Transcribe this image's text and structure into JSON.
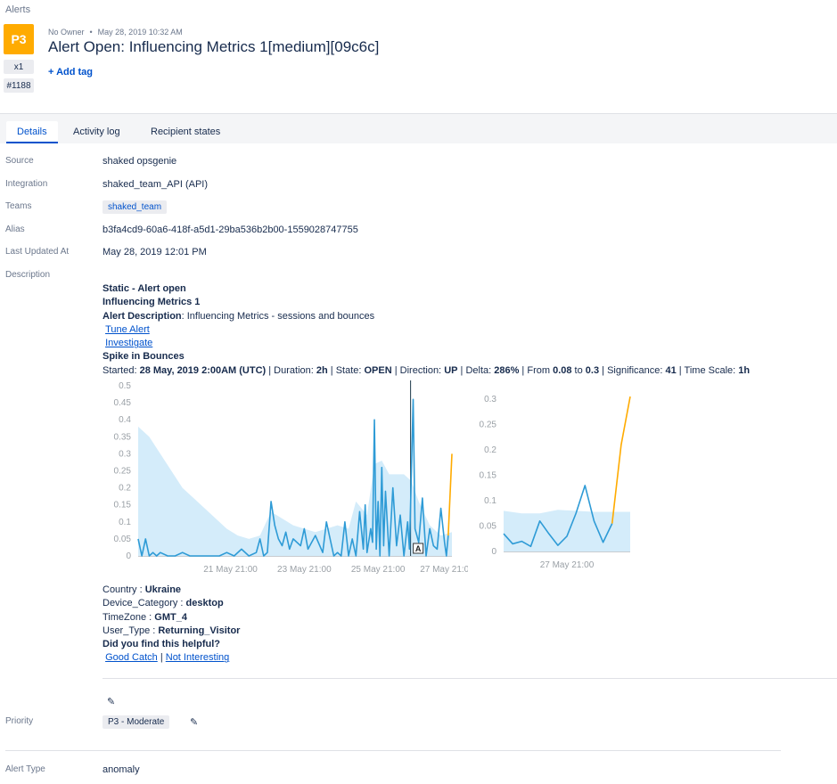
{
  "breadcrumb": "Alerts",
  "alert": {
    "priority_badge": "P3",
    "count": "x1",
    "tiny_id": "#1188",
    "owner": "No Owner",
    "created": "May 28, 2019 10:32 AM",
    "title": "Alert Open: Influencing Metrics 1[medium][09c6c]",
    "add_tag": "+ Add tag"
  },
  "tabs": [
    "Details",
    "Activity log",
    "Recipient states"
  ],
  "details": {
    "source_label": "Source",
    "source": "shaked opsgenie",
    "integration_label": "Integration",
    "integration": "shaked_team_API (API)",
    "teams_label": "Teams",
    "team": "shaked_team",
    "alias_label": "Alias",
    "alias": "b3fa4cd9-60a6-418f-a5d1-29ba536b2b00-1559028747755",
    "updated_label": "Last Updated At",
    "updated": "May 28, 2019 12:01 PM",
    "description_label": "Description",
    "priority_label": "Priority",
    "priority": "P3 - Moderate",
    "type_label": "Alert Type",
    "type": "anomaly"
  },
  "description": {
    "line1": "Static - Alert open",
    "line2": "Influencing Metrics 1",
    "desc_key": "Alert Description",
    "desc_val": ": Influencing Metrics - sessions and bounces",
    "tune_link": "Tune Alert",
    "investigate_link": "Investigate",
    "spike": "Spike in Bounces",
    "started_pre": "Started: ",
    "started": "28 May, 2019 2:00AM (UTC)",
    "duration_pre": " | Duration: ",
    "duration": "2h",
    "state_pre": " | State: ",
    "state": "OPEN",
    "direction_pre": " | Direction: ",
    "direction": "UP",
    "delta_pre": " | Delta: ",
    "delta": "286%",
    "from_pre": " | From ",
    "from": "0.08",
    "to_pre": " to ",
    "to": "0.3",
    "sig_pre": " | Significance: ",
    "sig": "41",
    "ts_pre": " | Time Scale: ",
    "ts": "1h",
    "country_key": "Country : ",
    "country": "Ukraine",
    "device_key": "Device_Category : ",
    "device": "desktop",
    "tz_key": "TimeZone : ",
    "tz": "GMT_4",
    "user_key": "User_Type : ",
    "user": "Returning_Visitor",
    "helpful": "Did you find this helpful?",
    "good_catch": "Good Catch",
    "sep": " | ",
    "not_interesting": "Not Interesting"
  },
  "chart_data": [
    {
      "type": "line",
      "ylim": [
        0,
        0.5
      ],
      "yticks": [
        0,
        0.05,
        0.1,
        0.15,
        0.2,
        0.25,
        0.3,
        0.35,
        0.4,
        0.45,
        0.5
      ],
      "xticks": [
        "21 May 21:00",
        "23 May 21:00",
        "25 May 21:00",
        "27 May 21:0"
      ],
      "xtick_pos": [
        2.5,
        4.5,
        6.5,
        8.3
      ],
      "xlim": [
        0,
        8.5
      ],
      "annotation": "A",
      "series": [
        {
          "color": "#2e9bd6",
          "points": [
            [
              0.0,
              0.05
            ],
            [
              0.1,
              0.0
            ],
            [
              0.2,
              0.05
            ],
            [
              0.3,
              0.0
            ],
            [
              0.4,
              0.01
            ],
            [
              0.5,
              0.0
            ],
            [
              0.6,
              0.01
            ],
            [
              0.8,
              0.0
            ],
            [
              1.0,
              0.0
            ],
            [
              1.2,
              0.01
            ],
            [
              1.4,
              0.0
            ],
            [
              1.6,
              0.0
            ],
            [
              1.8,
              0.0
            ],
            [
              2.0,
              0.0
            ],
            [
              2.2,
              0.0
            ],
            [
              2.4,
              0.01
            ],
            [
              2.6,
              0.0
            ],
            [
              2.8,
              0.02
            ],
            [
              3.0,
              0.0
            ],
            [
              3.2,
              0.01
            ],
            [
              3.3,
              0.05
            ],
            [
              3.4,
              0.0
            ],
            [
              3.5,
              0.01
            ],
            [
              3.6,
              0.16
            ],
            [
              3.7,
              0.09
            ],
            [
              3.8,
              0.05
            ],
            [
              3.9,
              0.03
            ],
            [
              4.0,
              0.07
            ],
            [
              4.1,
              0.02
            ],
            [
              4.2,
              0.05
            ],
            [
              4.4,
              0.03
            ],
            [
              4.5,
              0.08
            ],
            [
              4.6,
              0.02
            ],
            [
              4.7,
              0.04
            ],
            [
              4.8,
              0.06
            ],
            [
              5.0,
              0.01
            ],
            [
              5.1,
              0.1
            ],
            [
              5.2,
              0.05
            ],
            [
              5.3,
              0.0
            ],
            [
              5.4,
              0.01
            ],
            [
              5.5,
              0.0
            ],
            [
              5.6,
              0.1
            ],
            [
              5.7,
              0.0
            ],
            [
              5.8,
              0.05
            ],
            [
              5.9,
              0.0
            ],
            [
              6.0,
              0.13
            ],
            [
              6.1,
              0.02
            ],
            [
              6.15,
              0.15
            ],
            [
              6.2,
              0.01
            ],
            [
              6.3,
              0.08
            ],
            [
              6.35,
              0.04
            ],
            [
              6.4,
              0.4
            ],
            [
              6.45,
              0.02
            ],
            [
              6.5,
              0.16
            ],
            [
              6.55,
              0.0
            ],
            [
              6.6,
              0.26
            ],
            [
              6.65,
              0.03
            ],
            [
              6.7,
              0.19
            ],
            [
              6.8,
              0.0
            ],
            [
              6.9,
              0.2
            ],
            [
              7.0,
              0.03
            ],
            [
              7.1,
              0.12
            ],
            [
              7.2,
              0.0
            ],
            [
              7.3,
              0.1
            ],
            [
              7.35,
              0.02
            ],
            [
              7.45,
              0.46
            ],
            [
              7.5,
              0.08
            ],
            [
              7.6,
              0.04
            ],
            [
              7.7,
              0.17
            ],
            [
              7.8,
              0.0
            ],
            [
              7.9,
              0.08
            ],
            [
              8.0,
              0.03
            ],
            [
              8.1,
              0.02
            ],
            [
              8.2,
              0.14
            ],
            [
              8.3,
              0.04
            ],
            [
              8.35,
              0.0
            ],
            [
              8.4,
              0.06
            ]
          ]
        },
        {
          "color": "#ffab00",
          "points": [
            [
              8.4,
              0.06
            ],
            [
              8.5,
              0.3
            ]
          ]
        }
      ],
      "band": [
        [
          0.0,
          0.38
        ],
        [
          0.3,
          0.35
        ],
        [
          0.6,
          0.3
        ],
        [
          0.9,
          0.25
        ],
        [
          1.2,
          0.2
        ],
        [
          1.5,
          0.17
        ],
        [
          1.8,
          0.14
        ],
        [
          2.1,
          0.11
        ],
        [
          2.4,
          0.08
        ],
        [
          2.7,
          0.06
        ],
        [
          3.0,
          0.05
        ],
        [
          3.3,
          0.06
        ],
        [
          3.6,
          0.13
        ],
        [
          3.9,
          0.11
        ],
        [
          4.2,
          0.09
        ],
        [
          4.5,
          0.08
        ],
        [
          4.8,
          0.07
        ],
        [
          5.1,
          0.08
        ],
        [
          5.4,
          0.09
        ],
        [
          5.7,
          0.08
        ],
        [
          5.9,
          0.16
        ],
        [
          6.2,
          0.12
        ],
        [
          6.4,
          0.27
        ],
        [
          6.6,
          0.28
        ],
        [
          6.8,
          0.24
        ],
        [
          7.0,
          0.24
        ],
        [
          7.2,
          0.24
        ],
        [
          7.4,
          0.22
        ],
        [
          7.6,
          0.16
        ],
        [
          7.9,
          0.09
        ],
        [
          8.2,
          0.06
        ],
        [
          8.5,
          0.07
        ]
      ],
      "marker_x": 7.38
    },
    {
      "type": "line",
      "ylim": [
        0,
        0.3
      ],
      "yticks": [
        0,
        0.05,
        0.1,
        0.15,
        0.2,
        0.25,
        0.3
      ],
      "xticks": [
        "27 May 21:00"
      ],
      "xtick_pos": [
        6
      ],
      "xlim": [
        0,
        12
      ],
      "series": [
        {
          "color": "#2e9bd6",
          "points": [
            [
              0,
              0.035
            ],
            [
              1,
              0.015
            ],
            [
              2,
              0.02
            ],
            [
              3,
              0.01
            ],
            [
              4,
              0.06
            ],
            [
              5,
              0.035
            ],
            [
              6,
              0.012
            ],
            [
              7,
              0.03
            ],
            [
              8,
              0.075
            ],
            [
              9,
              0.13
            ],
            [
              10,
              0.06
            ],
            [
              11,
              0.018
            ],
            [
              12,
              0.055
            ]
          ]
        },
        {
          "color": "#ffab00",
          "points": [
            [
              12,
              0.055
            ],
            [
              13,
              0.21
            ],
            [
              14,
              0.305
            ]
          ]
        }
      ],
      "band": [
        [
          0,
          0.08
        ],
        [
          2,
          0.075
        ],
        [
          4,
          0.075
        ],
        [
          6,
          0.082
        ],
        [
          8,
          0.08
        ],
        [
          10,
          0.078
        ],
        [
          12,
          0.078
        ],
        [
          14,
          0.078
        ]
      ]
    }
  ]
}
